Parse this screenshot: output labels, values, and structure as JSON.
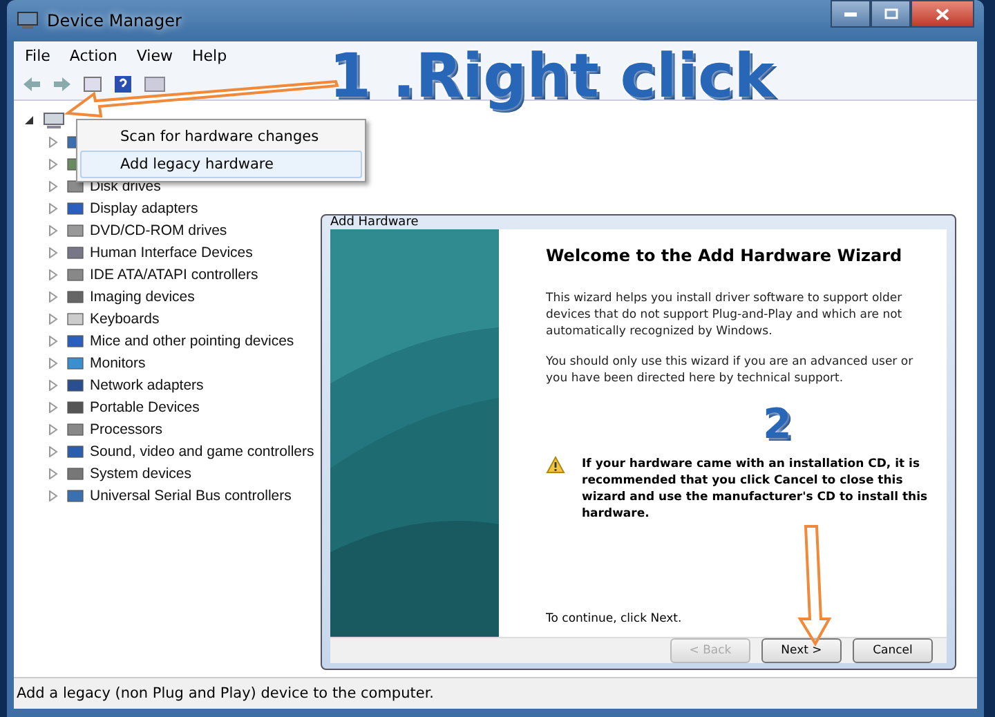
{
  "window": {
    "title": "Device Manager"
  },
  "menu": [
    {
      "label": "File"
    },
    {
      "label": "Action"
    },
    {
      "label": "View"
    },
    {
      "label": "Help"
    }
  ],
  "tree": {
    "expanded": true,
    "children": [
      {
        "expanded": false
      },
      {
        "expanded": false
      },
      {
        "label": "Disk drives",
        "expanded": false
      },
      {
        "label": "Display adapters",
        "expanded": false
      },
      {
        "label": "DVD/CD-ROM drives",
        "expanded": false
      },
      {
        "label": "Human Interface Devices",
        "expanded": false
      },
      {
        "label": "IDE ATA/ATAPI controllers",
        "expanded": false
      },
      {
        "label": "Imaging devices",
        "expanded": false
      },
      {
        "label": "Keyboards",
        "expanded": false
      },
      {
        "label": "Mice and other pointing devices",
        "expanded": false
      },
      {
        "label": "Monitors",
        "expanded": false
      },
      {
        "label": "Network adapters",
        "expanded": false
      },
      {
        "label": "Portable Devices",
        "expanded": false
      },
      {
        "label": "Processors",
        "expanded": false
      },
      {
        "label": "Sound, video and game controllers",
        "expanded": false
      },
      {
        "label": "System devices",
        "expanded": false
      },
      {
        "label": "Universal Serial Bus controllers",
        "expanded": false
      }
    ]
  },
  "context_menu": [
    {
      "label": "Scan for hardware changes",
      "selected": false
    },
    {
      "label": "Add legacy hardware",
      "selected": true
    }
  ],
  "dialog": {
    "title": "Add Hardware",
    "heading": "Welcome to the Add Hardware Wizard",
    "paragraphs": [
      "This wizard helps you install driver software to support older devices that do not support Plug-and-Play and which are not automatically recognized by Windows.",
      "You should only use this wizard if you are an advanced user or you have been directed here by technical support."
    ],
    "warning": "If your hardware came with an installation CD, it is recommended that you click Cancel to close this wizard and use the manufacturer's CD to install this hardware.",
    "footer": "To continue, click Next.",
    "buttons": [
      {
        "label": "< Back",
        "disabled": true
      },
      {
        "label": "Next >",
        "disabled": false
      },
      {
        "label": "Cancel",
        "disabled": false
      }
    ]
  },
  "status_bar": "Add a legacy (non Plug and Play) device to the computer.",
  "annotations": [
    {
      "kind": "callout",
      "text": "1 .Right click"
    },
    {
      "kind": "step",
      "text": "2"
    }
  ]
}
